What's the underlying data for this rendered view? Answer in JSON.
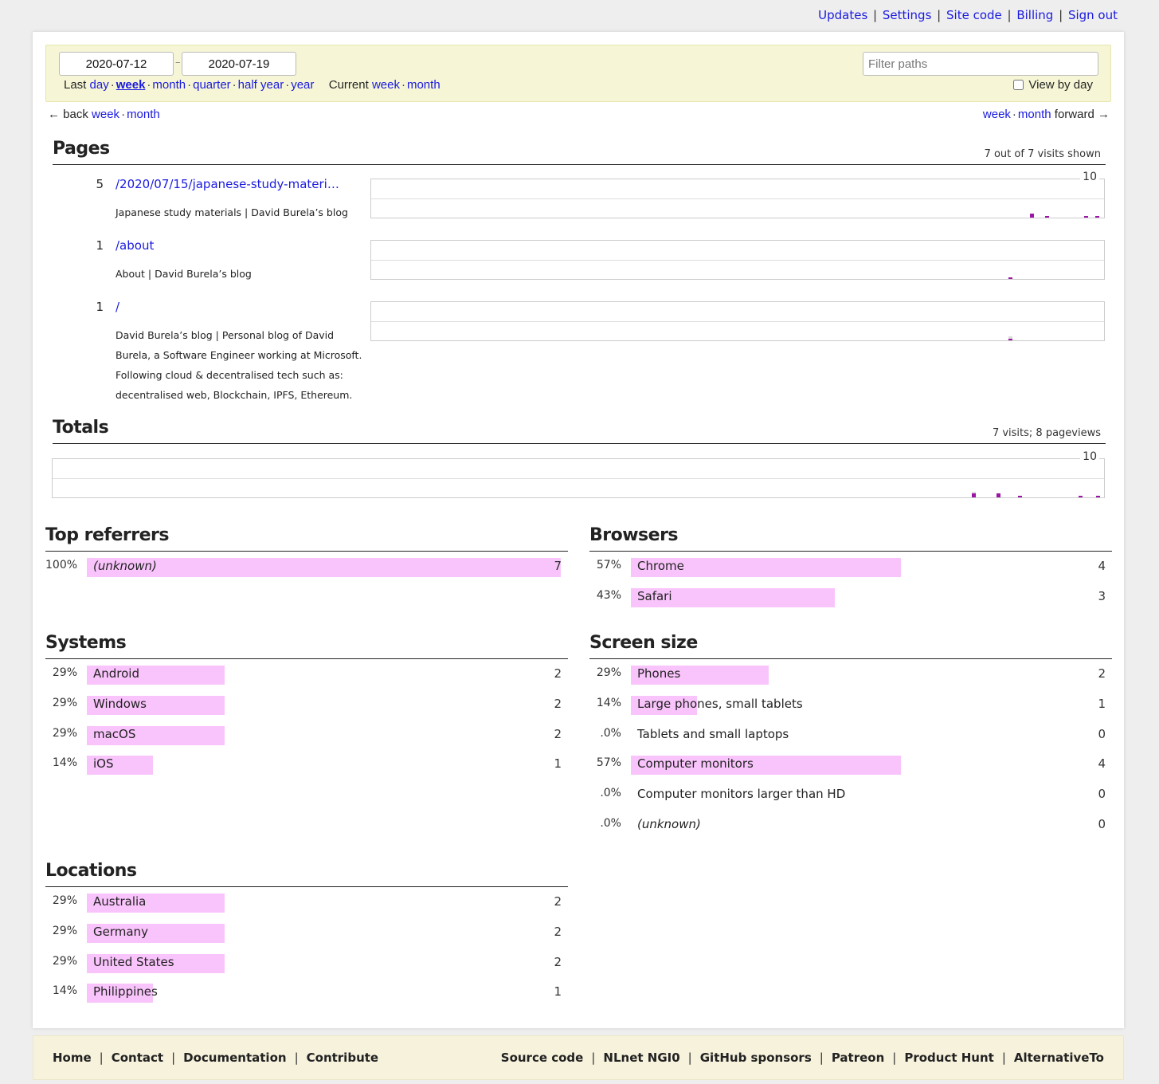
{
  "top_nav": {
    "links": [
      "Updates",
      "Settings",
      "Site code",
      "Billing",
      "Sign out"
    ]
  },
  "filter": {
    "start_date": "2020-07-12",
    "end_date": "2020-07-19",
    "last_label": "Last",
    "last_links": [
      "day",
      "week",
      "month",
      "quarter",
      "half year",
      "year"
    ],
    "active_last": "week",
    "current_label": "Current",
    "current_links": [
      "week",
      "month"
    ],
    "filter_placeholder": "Filter paths",
    "filter_value": "",
    "view_by_day_label": "View by day",
    "view_by_day_checked": false
  },
  "period_nav": {
    "back_arrow": "←",
    "back_label": "back",
    "back_links": [
      "week",
      "month"
    ],
    "forward_links": [
      "week",
      "month"
    ],
    "forward_label": "forward",
    "forward_arrow": "→"
  },
  "pages": {
    "title": "Pages",
    "summary": "7 out of 7 visits shown",
    "chart_max": "10",
    "rows": [
      {
        "count": "5",
        "path": "/2020/07/15/japanese-study-materi…",
        "title": "Japanese study materials | David Burela’s blog",
        "visits_by_hour": [
          {
            "hour": 152,
            "visits": 2,
            "pageviews": 2
          },
          {
            "hour": 155.5,
            "visits": 1,
            "pageviews": 1
          },
          {
            "hour": 164.5,
            "visits": 1,
            "pageviews": 1
          },
          {
            "hour": 167,
            "visits": 1,
            "pageviews": 1
          }
        ]
      },
      {
        "count": "1",
        "path": "/about",
        "title": "About | David Burela’s blog",
        "visits_by_hour": [
          {
            "hour": 147,
            "visits": 1,
            "pageviews": 1
          }
        ]
      },
      {
        "count": "1",
        "path": "/",
        "title": "David Burela’s blog | Personal blog of David Burela, a Software Engineer working at Microsoft. Following cloud & decentralised tech such as: decentralised web, Blockchain, IPFS, Ethereum.",
        "visits_by_hour": [
          {
            "hour": 147,
            "visits": 1,
            "pageviews": 2
          }
        ]
      }
    ]
  },
  "totals": {
    "title": "Totals",
    "summary": "7 visits; 8 pageviews",
    "chart_max": "10",
    "visits_by_hour": [
      {
        "hour": 147.5,
        "visits": 2,
        "pageviews": 3
      },
      {
        "hour": 151.5,
        "visits": 2,
        "pageviews": 2
      },
      {
        "hour": 155,
        "visits": 1,
        "pageviews": 1
      },
      {
        "hour": 164.7,
        "visits": 1,
        "pageviews": 1
      },
      {
        "hour": 167.5,
        "visits": 1,
        "pageviews": 1
      }
    ]
  },
  "top_referrers": {
    "title": "Top referrers",
    "rows": [
      {
        "pct": "100%",
        "fraction": 1.0,
        "label": "(unknown)",
        "italic": true,
        "count": "7"
      }
    ]
  },
  "browsers": {
    "title": "Browsers",
    "rows": [
      {
        "pct": "57%",
        "fraction": 0.57,
        "label": "Chrome",
        "count": "4"
      },
      {
        "pct": "43%",
        "fraction": 0.43,
        "label": "Safari",
        "count": "3"
      }
    ]
  },
  "systems": {
    "title": "Systems",
    "rows": [
      {
        "pct": "29%",
        "fraction": 0.29,
        "label": "Android",
        "count": "2"
      },
      {
        "pct": "29%",
        "fraction": 0.29,
        "label": "Windows",
        "count": "2"
      },
      {
        "pct": "29%",
        "fraction": 0.29,
        "label": "macOS",
        "count": "2"
      },
      {
        "pct": "14%",
        "fraction": 0.14,
        "label": "iOS",
        "count": "1"
      }
    ]
  },
  "screen_size": {
    "title": "Screen size",
    "rows": [
      {
        "pct": "29%",
        "fraction": 0.29,
        "label": "Phones",
        "count": "2"
      },
      {
        "pct": "14%",
        "fraction": 0.14,
        "label": "Large phones, small tablets",
        "count": "1"
      },
      {
        "pct": ".0%",
        "fraction": 0,
        "label": "Tablets and small laptops",
        "count": "0"
      },
      {
        "pct": "57%",
        "fraction": 0.57,
        "label": "Computer monitors",
        "count": "4"
      },
      {
        "pct": ".0%",
        "fraction": 0,
        "label": "Computer monitors larger than HD",
        "count": "0"
      },
      {
        "pct": ".0%",
        "fraction": 0,
        "label": "(unknown)",
        "italic": true,
        "count": "0"
      }
    ]
  },
  "locations": {
    "title": "Locations",
    "rows": [
      {
        "pct": "29%",
        "fraction": 0.29,
        "label": "Australia",
        "count": "2"
      },
      {
        "pct": "29%",
        "fraction": 0.29,
        "label": "Germany",
        "count": "2"
      },
      {
        "pct": "29%",
        "fraction": 0.29,
        "label": "United States",
        "count": "2"
      },
      {
        "pct": "14%",
        "fraction": 0.14,
        "label": "Philippines",
        "count": "1"
      }
    ]
  },
  "footer": {
    "left_links": [
      "Home",
      "Contact",
      "Documentation",
      "Contribute"
    ],
    "right_links": [
      "Source code",
      "NLnet NGI0",
      "GitHub sponsors",
      "Patreon",
      "Product Hunt",
      "AlternativeTo"
    ]
  },
  "colors": {
    "link": "#1a1ae0",
    "visit_bar": "#9a15a4",
    "pageview_bar": "#dcdcdc",
    "hbar": "#f9c4fb",
    "filter_bg": "#f6f6d6",
    "footer_bg": "#f7f2dc"
  }
}
